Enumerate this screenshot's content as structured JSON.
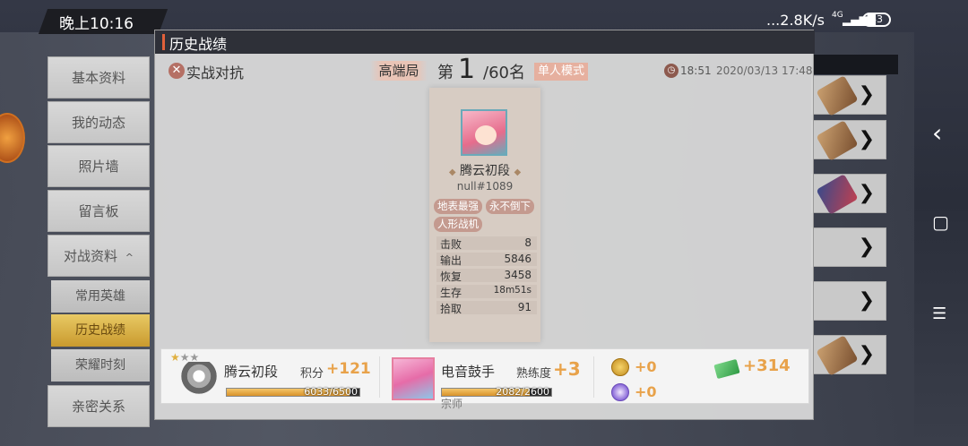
{
  "status_bar": {
    "time": "晚上10:16",
    "network": "...2.8K/s",
    "signal": "4G",
    "battery": "43"
  },
  "sidebar": {
    "items": [
      {
        "label": "基本资料"
      },
      {
        "label": "我的动态"
      },
      {
        "label": "照片墙"
      },
      {
        "label": "留言板"
      },
      {
        "label": "对战资料"
      }
    ],
    "sub_items": [
      {
        "label": "常用英雄"
      },
      {
        "label": "历史战绩"
      },
      {
        "label": "荣耀时刻"
      }
    ],
    "bottom_item": "亲密关系",
    "expand_glyph": "^"
  },
  "dialog": {
    "title": "历史战绩",
    "mode": "实战对抗",
    "tier": "高端局",
    "rank_prefix": "第",
    "rank": "1",
    "rank_total": "/60名",
    "mode_tag": "单人模式",
    "duration": "18:51",
    "datetime": "2020/03/13 17:48"
  },
  "card": {
    "rank_name": "腾云初段",
    "player_id": "null#1089",
    "badges": [
      "地表最强",
      "永不倒下",
      "人形战机"
    ],
    "stats": [
      {
        "label": "击败",
        "value": "8"
      },
      {
        "label": "输出",
        "value": "5846"
      },
      {
        "label": "恢复",
        "value": "3458"
      },
      {
        "label": "生存",
        "value": "18m51s"
      },
      {
        "label": "拾取",
        "value": "91"
      }
    ]
  },
  "rewards": {
    "rank_name": "腾云初段",
    "score_label": "积分",
    "score_delta": "+121",
    "score_bar_text": "6033/6500",
    "score_progress": 0.928,
    "hero_name": "电音鼓手",
    "prof_label": "熟练度",
    "prof_delta": "+3",
    "prof_bar_text": "2082/2600",
    "prof_progress": 0.8,
    "hero_title": "宗师",
    "coin_delta": "+0",
    "orb_delta": "+0",
    "ticket_delta": "+314"
  },
  "nav": {
    "back": "‹",
    "home": "▢",
    "menu": "☰"
  },
  "colors": {
    "accent": "#e8a24a",
    "tag": "#e6b09f",
    "badge": "#c49a8f"
  }
}
